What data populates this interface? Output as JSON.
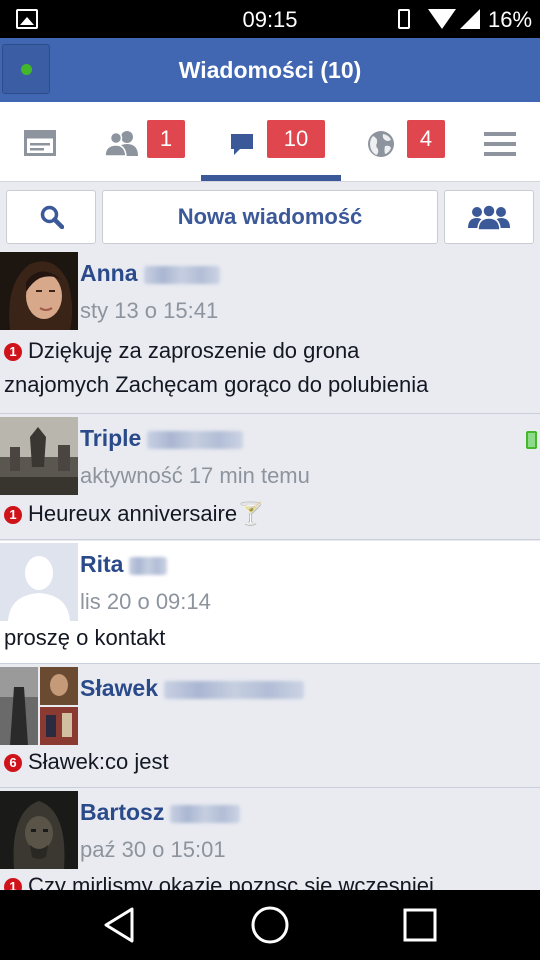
{
  "status_bar": {
    "time": "09:15",
    "battery": "16%"
  },
  "header": {
    "title": "Wiadomości (10)"
  },
  "tabs": {
    "friends_badge": "1",
    "messages_badge": "10",
    "notifications_badge": "4"
  },
  "actions": {
    "new_message_label": "Nowa wiadomość"
  },
  "conversations": [
    {
      "name": "Anna",
      "meta": "sty 13 o 15:41",
      "unread_count": "1",
      "message_line1": "Dziękuję za zaproszenie do grona",
      "message_line2": "znajomych  Zachęcam gorąco do polubienia"
    },
    {
      "name": "Triple",
      "meta": "aktywność 17 min temu",
      "unread_count": "1",
      "message": "Heureux anniversaire🍸"
    },
    {
      "name": "Rita",
      "meta": "lis 20 o 09:14",
      "message": "proszę o kontakt"
    },
    {
      "name": "Sławek",
      "unread_count": "6",
      "message": "Sławek:co jest"
    },
    {
      "name": "Bartosz",
      "meta": "paź 30 o 15:01",
      "unread_count": "1",
      "message": "Czy mirlismy okazje poznsc sie wczesniej"
    }
  ],
  "colors": {
    "brand_blue": "#4267b2",
    "badge_red": "#e0464e",
    "online_green": "#42b72a"
  }
}
